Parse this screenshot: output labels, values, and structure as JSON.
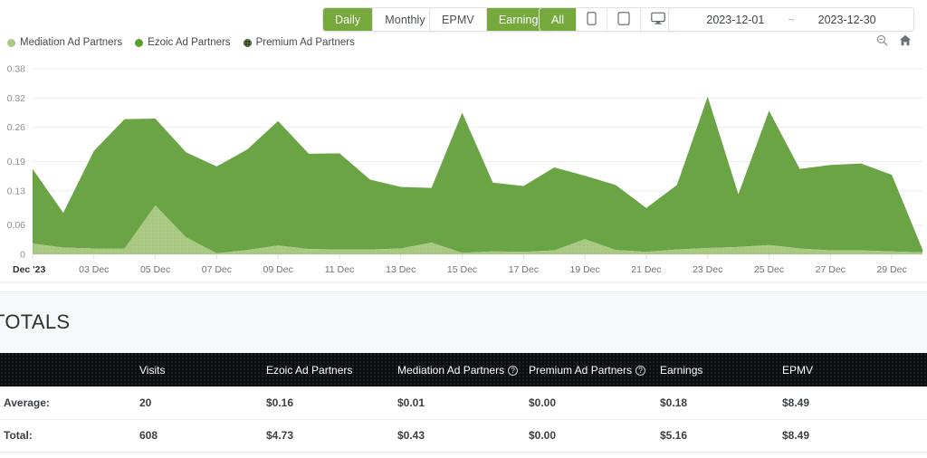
{
  "toolbar": {
    "groups": [
      {
        "name": "interval",
        "buttons": [
          {
            "label": "Daily",
            "active": true
          },
          {
            "label": "Monthly",
            "active": false
          }
        ]
      },
      {
        "name": "metric",
        "buttons": [
          {
            "label": "EPMV",
            "active": false
          },
          {
            "label": "Earnings",
            "active": true
          }
        ]
      },
      {
        "name": "device",
        "buttons": [
          {
            "label": "All",
            "active": true
          },
          {
            "label": "mobile-icon",
            "active": false,
            "icon": "mobile"
          },
          {
            "label": "tablet-icon",
            "active": false,
            "icon": "tablet"
          },
          {
            "label": "desktop-icon",
            "active": false,
            "icon": "desktop"
          }
        ]
      }
    ],
    "date_range": {
      "start": "2023-12-01",
      "separator": "~",
      "end": "2023-12-30"
    },
    "icons": {
      "zoom_out": "zoom-out-icon",
      "home": "home-icon"
    }
  },
  "legend": {
    "items": [
      {
        "label": "Mediation Ad Partners",
        "color": "#a9c984"
      },
      {
        "label": "Ezoic Ad Partners",
        "color": "#5a9e2f"
      },
      {
        "label": "Premium Ad Partners",
        "color": "#2f3e21"
      }
    ]
  },
  "chart_data": {
    "type": "area",
    "stacked": true,
    "title": "",
    "xlabel": "",
    "ylabel": "",
    "ylim": [
      0,
      0.38
    ],
    "grid": true,
    "legend_position": "top-left",
    "y_ticks": [
      "0",
      "0.06",
      "0.13",
      "0.19",
      "0.26",
      "0.32",
      "0.38"
    ],
    "y_tick_values": [
      0,
      0.06,
      0.13,
      0.19,
      0.26,
      0.32,
      0.38
    ],
    "x": [
      "Dec 01",
      "Dec 02",
      "Dec 03",
      "Dec 04",
      "Dec 05",
      "Dec 06",
      "Dec 07",
      "Dec 08",
      "Dec 09",
      "Dec 10",
      "Dec 11",
      "Dec 12",
      "Dec 13",
      "Dec 14",
      "Dec 15",
      "Dec 16",
      "Dec 17",
      "Dec 18",
      "Dec 19",
      "Dec 20",
      "Dec 21",
      "Dec 22",
      "Dec 23",
      "Dec 24",
      "Dec 25",
      "Dec 26",
      "Dec 27",
      "Dec 28",
      "Dec 29",
      "Dec 30"
    ],
    "x_tick_labels": [
      "Dec '23",
      "03 Dec",
      "05 Dec",
      "07 Dec",
      "09 Dec",
      "11 Dec",
      "13 Dec",
      "15 Dec",
      "17 Dec",
      "19 Dec",
      "21 Dec",
      "23 Dec",
      "25 Dec",
      "27 Dec",
      "29 Dec"
    ],
    "x_tick_indices": [
      0,
      2,
      4,
      6,
      8,
      10,
      12,
      14,
      16,
      18,
      20,
      22,
      24,
      26,
      28
    ],
    "series": [
      {
        "name": "Mediation Ad Partners",
        "color": "#a9c984",
        "values": [
          0.022,
          0.014,
          0.012,
          0.012,
          0.1,
          0.035,
          0.002,
          0.009,
          0.018,
          0.011,
          0.01,
          0.01,
          0.012,
          0.024,
          0.003,
          0.006,
          0.005,
          0.008,
          0.031,
          0.009,
          0.005,
          0.01,
          0.013,
          0.015,
          0.019,
          0.012,
          0.008,
          0.008,
          0.006,
          0.004
        ]
      },
      {
        "name": "Ezoic Ad Partners",
        "color": "#6aa444",
        "values": [
          0.153,
          0.071,
          0.2,
          0.265,
          0.178,
          0.174,
          0.178,
          0.206,
          0.255,
          0.195,
          0.197,
          0.143,
          0.126,
          0.112,
          0.287,
          0.141,
          0.135,
          0.17,
          0.13,
          0.133,
          0.09,
          0.132,
          0.31,
          0.108,
          0.275,
          0.163,
          0.175,
          0.178,
          0.157,
          0.006
        ]
      },
      {
        "name": "Premium Ad Partners",
        "color": "#2f3e21",
        "values": [
          0,
          0,
          0,
          0,
          0,
          0,
          0,
          0,
          0,
          0,
          0,
          0,
          0,
          0,
          0,
          0,
          0,
          0,
          0,
          0,
          0,
          0,
          0,
          0,
          0,
          0,
          0,
          0,
          0,
          0
        ]
      }
    ]
  },
  "totals": {
    "title": "TOTALS",
    "columns": [
      "",
      "Visits",
      "Ezoic Ad Partners",
      "Mediation Ad Partners",
      "Premium Ad Partners",
      "Earnings",
      "EPMV"
    ],
    "columns_with_help": [
      "Mediation Ad Partners",
      "Premium Ad Partners"
    ],
    "help_glyph": "?",
    "rows": [
      {
        "label": "Average:",
        "visits": "20",
        "ezoic": "$0.16",
        "mediation": "$0.01",
        "premium": "$0.00",
        "earnings": "$0.18",
        "epmv": "$8.49"
      },
      {
        "label": "Total:",
        "visits": "608",
        "ezoic": "$4.73",
        "mediation": "$0.43",
        "premium": "$0.00",
        "earnings": "$5.16",
        "epmv": "$8.49"
      }
    ]
  }
}
